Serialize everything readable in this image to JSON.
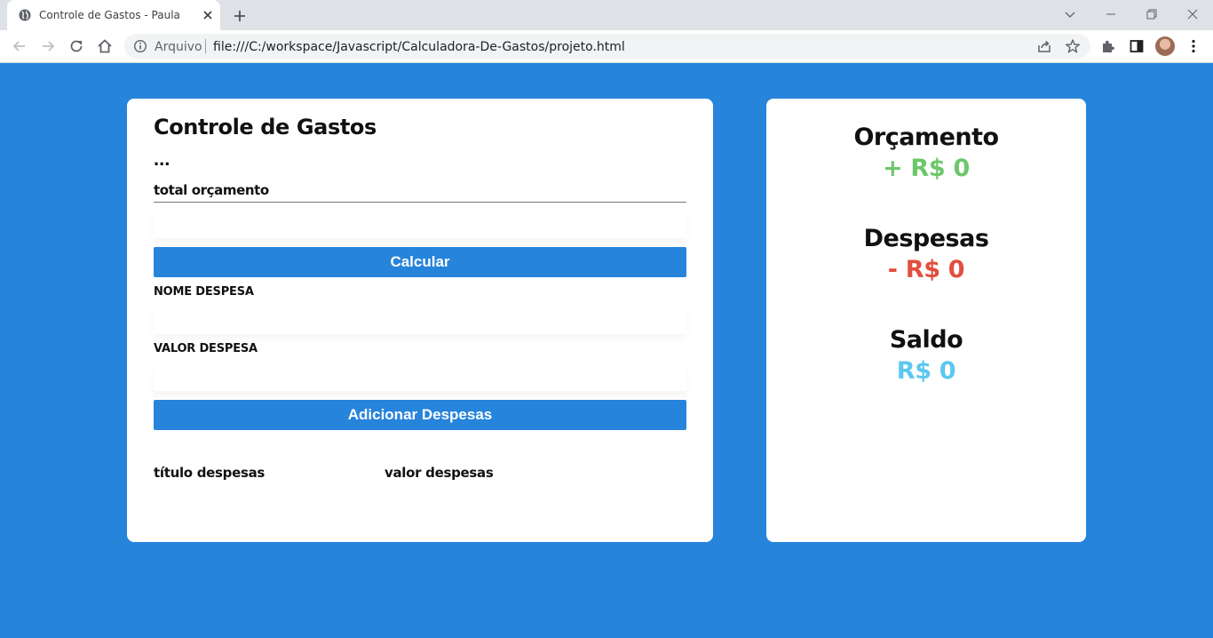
{
  "browser": {
    "tab_title": "Controle de Gastos - Paula",
    "origin_label": "Arquivo",
    "url": "file:///C:/workspace/Javascript/Calculadora-De-Gastos/projeto.html"
  },
  "form": {
    "title": "Controle de Gastos",
    "ellipsis": "...",
    "budget_label": "total orçamento",
    "budget_value": "",
    "calculate_button": "Calcular",
    "expense_name_label": "NOME DESPESA",
    "expense_name_value": "",
    "expense_value_label": "VALOR DESPESA",
    "expense_value_value": "",
    "add_button": "Adicionar Despesas",
    "list_headers": [
      "título despesas",
      "valor despesas"
    ]
  },
  "summary": {
    "budget_title": "Orçamento",
    "budget_value": "+ R$ 0",
    "expenses_title": "Despesas",
    "expenses_value": "- R$ 0",
    "balance_title": "Saldo",
    "balance_value": "R$ 0"
  },
  "colors": {
    "page_background": "#2684db",
    "budget_value": "#6cc76b",
    "expenses_value": "#e04f3f",
    "balance_value": "#5bc8f0"
  }
}
